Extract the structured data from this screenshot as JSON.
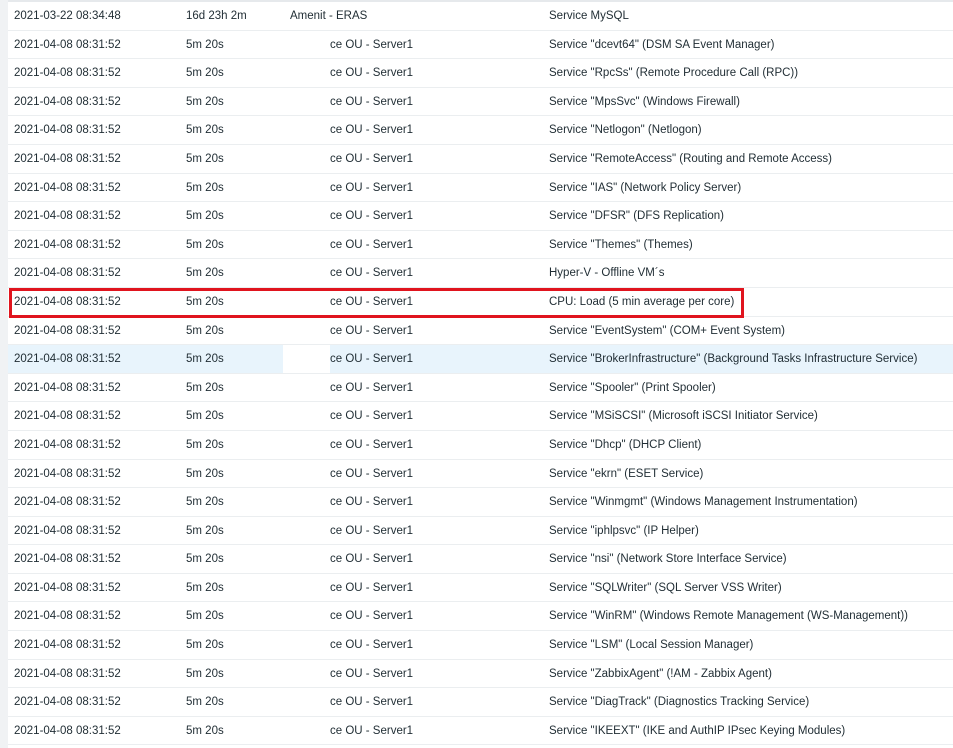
{
  "highlight_color": "#e0141e",
  "selected_row_index": 12,
  "outlined_row_index": 10,
  "rows": [
    {
      "time": "2021-03-22 08:34:48",
      "duration": "16d 23h 2m",
      "host": "Amenit - ERAS",
      "description": "Service MySQL"
    },
    {
      "time": "2021-04-08 08:31:52",
      "duration": "5m 20s",
      "host": "ce OU - Server1",
      "description": "Service \"dcevt64\" (DSM SA Event Manager)"
    },
    {
      "time": "2021-04-08 08:31:52",
      "duration": "5m 20s",
      "host": "ce OU - Server1",
      "description": "Service \"RpcSs\" (Remote Procedure Call (RPC))"
    },
    {
      "time": "2021-04-08 08:31:52",
      "duration": "5m 20s",
      "host": "ce OU - Server1",
      "description": "Service \"MpsSvc\" (Windows Firewall)"
    },
    {
      "time": "2021-04-08 08:31:52",
      "duration": "5m 20s",
      "host": "ce OU - Server1",
      "description": "Service \"Netlogon\" (Netlogon)"
    },
    {
      "time": "2021-04-08 08:31:52",
      "duration": "5m 20s",
      "host": "ce OU - Server1",
      "description": "Service \"RemoteAccess\" (Routing and Remote Access)"
    },
    {
      "time": "2021-04-08 08:31:52",
      "duration": "5m 20s",
      "host": "ce OU - Server1",
      "description": "Service \"IAS\" (Network Policy Server)"
    },
    {
      "time": "2021-04-08 08:31:52",
      "duration": "5m 20s",
      "host": "ce OU - Server1",
      "description": "Service \"DFSR\" (DFS Replication)"
    },
    {
      "time": "2021-04-08 08:31:52",
      "duration": "5m 20s",
      "host": "ce OU - Server1",
      "description": "Service \"Themes\" (Themes)"
    },
    {
      "time": "2021-04-08 08:31:52",
      "duration": "5m 20s",
      "host": "ce OU - Server1",
      "description": "Hyper-V - Offline VM´s"
    },
    {
      "time": "2021-04-08 08:31:52",
      "duration": "5m 20s",
      "host": "ce OU - Server1",
      "description": "CPU: Load (5 min average per core)"
    },
    {
      "time": "2021-04-08 08:31:52",
      "duration": "5m 20s",
      "host": "ce OU - Server1",
      "description": "Service \"EventSystem\" (COM+ Event System)"
    },
    {
      "time": "2021-04-08 08:31:52",
      "duration": "5m 20s",
      "host": "ce OU - Server1",
      "description": "Service \"BrokerInfrastructure\" (Background Tasks Infrastructure Service)"
    },
    {
      "time": "2021-04-08 08:31:52",
      "duration": "5m 20s",
      "host": "ce OU - Server1",
      "description": "Service \"Spooler\" (Print Spooler)"
    },
    {
      "time": "2021-04-08 08:31:52",
      "duration": "5m 20s",
      "host": "ce OU - Server1",
      "description": "Service \"MSiSCSI\" (Microsoft iSCSI Initiator Service)"
    },
    {
      "time": "2021-04-08 08:31:52",
      "duration": "5m 20s",
      "host": "ce OU - Server1",
      "description": "Service \"Dhcp\" (DHCP Client)"
    },
    {
      "time": "2021-04-08 08:31:52",
      "duration": "5m 20s",
      "host": "ce OU - Server1",
      "description": "Service \"ekrn\" (ESET Service)"
    },
    {
      "time": "2021-04-08 08:31:52",
      "duration": "5m 20s",
      "host": "ce OU - Server1",
      "description": "Service \"Winmgmt\" (Windows Management Instrumentation)"
    },
    {
      "time": "2021-04-08 08:31:52",
      "duration": "5m 20s",
      "host": "ce OU - Server1",
      "description": "Service \"iphlpsvc\" (IP Helper)"
    },
    {
      "time": "2021-04-08 08:31:52",
      "duration": "5m 20s",
      "host": "ce OU - Server1",
      "description": "Service \"nsi\" (Network Store Interface Service)"
    },
    {
      "time": "2021-04-08 08:31:52",
      "duration": "5m 20s",
      "host": "ce OU - Server1",
      "description": "Service \"SQLWriter\" (SQL Server VSS Writer)"
    },
    {
      "time": "2021-04-08 08:31:52",
      "duration": "5m 20s",
      "host": "ce OU - Server1",
      "description": "Service \"WinRM\" (Windows Remote Management (WS-Management))"
    },
    {
      "time": "2021-04-08 08:31:52",
      "duration": "5m 20s",
      "host": "ce OU - Server1",
      "description": "Service \"LSM\" (Local Session Manager)"
    },
    {
      "time": "2021-04-08 08:31:52",
      "duration": "5m 20s",
      "host": "ce OU - Server1",
      "description": "Service \"ZabbixAgent\" (!AM - Zabbix Agent)"
    },
    {
      "time": "2021-04-08 08:31:52",
      "duration": "5m 20s",
      "host": "ce OU - Server1",
      "description": "Service \"DiagTrack\" (Diagnostics Tracking Service)"
    },
    {
      "time": "2021-04-08 08:31:52",
      "duration": "5m 20s",
      "host": "ce OU - Server1",
      "description": "Service \"IKEEXT\" (IKE and AuthIP IPsec Keying Modules)"
    }
  ]
}
